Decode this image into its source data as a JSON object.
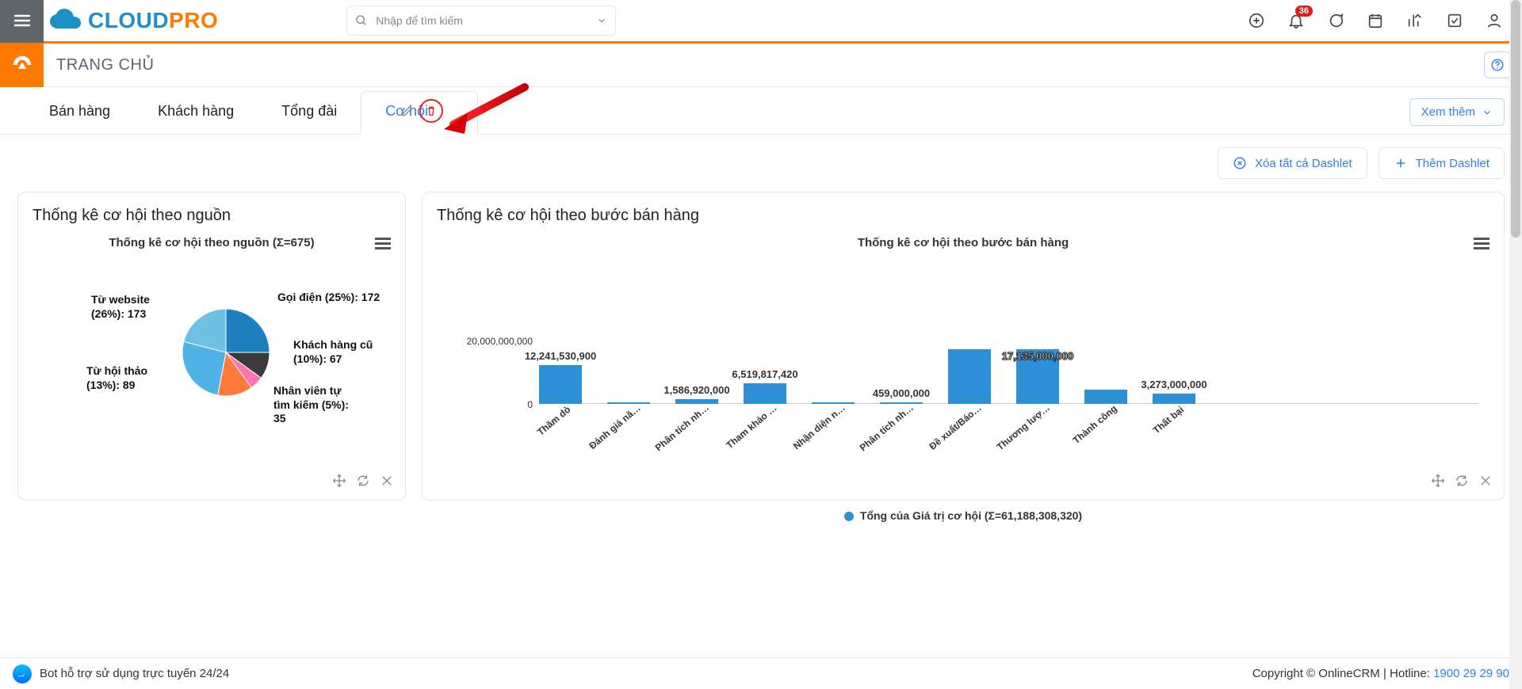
{
  "header": {
    "search_placeholder": "Nhập để tìm kiếm",
    "notification_count": "36"
  },
  "page": {
    "title": "TRANG CHỦ"
  },
  "tabs": [
    {
      "id": "ban-hang",
      "label": "Bán hàng",
      "active": false
    },
    {
      "id": "khach-hang",
      "label": "Khách hàng",
      "active": false
    },
    {
      "id": "tong-dai",
      "label": "Tổng đài",
      "active": false
    },
    {
      "id": "co-hoi",
      "label": "Cơ hội",
      "active": true
    }
  ],
  "buttons": {
    "view_more": "Xem thêm",
    "remove_all": "Xóa tất cả Dashlet",
    "add_dashlet": "Thêm Dashlet"
  },
  "dashlets": {
    "pie": {
      "card_title": "Thống kê cơ hội theo nguồn",
      "chart_title": "Thống kê cơ hội theo nguồn (Σ=675)"
    },
    "bar": {
      "card_title": "Thống kê cơ hội theo bước bán hàng",
      "chart_title": "Thống kê cơ hội theo bước bán hàng",
      "legend": "Tổng của Giá trị cơ hội (Σ=61,188,308,320)",
      "ytick0": "0",
      "ytick1": "20,000,000,000"
    }
  },
  "chart_data": [
    {
      "id": "pie_source",
      "type": "pie",
      "title": "Thống kê cơ hội theo nguồn (Σ=675)",
      "total": 675,
      "slices": [
        {
          "label": "Gọi điện",
          "percent": 25,
          "value": 172,
          "color": "#1e7fc1",
          "display": "Gọi điện (25%): 172"
        },
        {
          "label": "Khách hàng cũ",
          "percent": 10,
          "value": 67,
          "color": "#3a3a3a",
          "display": "Khách hàng cũ\n(10%): 67"
        },
        {
          "label": "Nhân viên tự tìm kiếm",
          "percent": 5,
          "value": 35,
          "color": "#ff73b3",
          "display": "Nhân viên tự\ntìm kiếm (5%):\n35"
        },
        {
          "label": "Từ hội thảo",
          "percent": 13,
          "value": 89,
          "color": "#ff7a3b",
          "display": "Từ hội thảo\n(13%): 89"
        },
        {
          "label": "Từ website",
          "percent": 26,
          "value": 173,
          "color": "#4fb3e8",
          "display": "Từ website\n(26%): 173"
        }
      ],
      "other_percent": 21
    },
    {
      "id": "bar_stage",
      "type": "bar",
      "title": "Thống kê cơ hội theo bước bán hàng",
      "ylabel": "",
      "ylim": [
        0,
        20000000000
      ],
      "sum": 61188308320,
      "categories": [
        "Thăm dò",
        "Đánh giá nă…",
        "Phân tích nh…",
        "Tham khảo …",
        "Nhận diện n…",
        "Phân tích nh…",
        "Đề xuất/Báo…",
        "Thương lượ…",
        "Thành công",
        "Thất bại"
      ],
      "values": [
        12241530900,
        200000000,
        1586920000,
        6519817420,
        600000000,
        459000000,
        17135000000,
        17135000000,
        4500000000,
        3273000000
      ],
      "value_labels": [
        "12,241,530,900",
        "",
        "1,586,920,000",
        "6,519,817,420",
        "",
        "459,000,000",
        "",
        "17,135,000,000",
        "",
        "3,273,000,000"
      ]
    }
  ],
  "footer": {
    "bot": "Bot hỗ trợ sử dụng trực tuyến 24/24",
    "copyright": "Copyright © OnlineCRM",
    "hotline_label": "Hotline: ",
    "hotline": "1900 29 29 90"
  }
}
